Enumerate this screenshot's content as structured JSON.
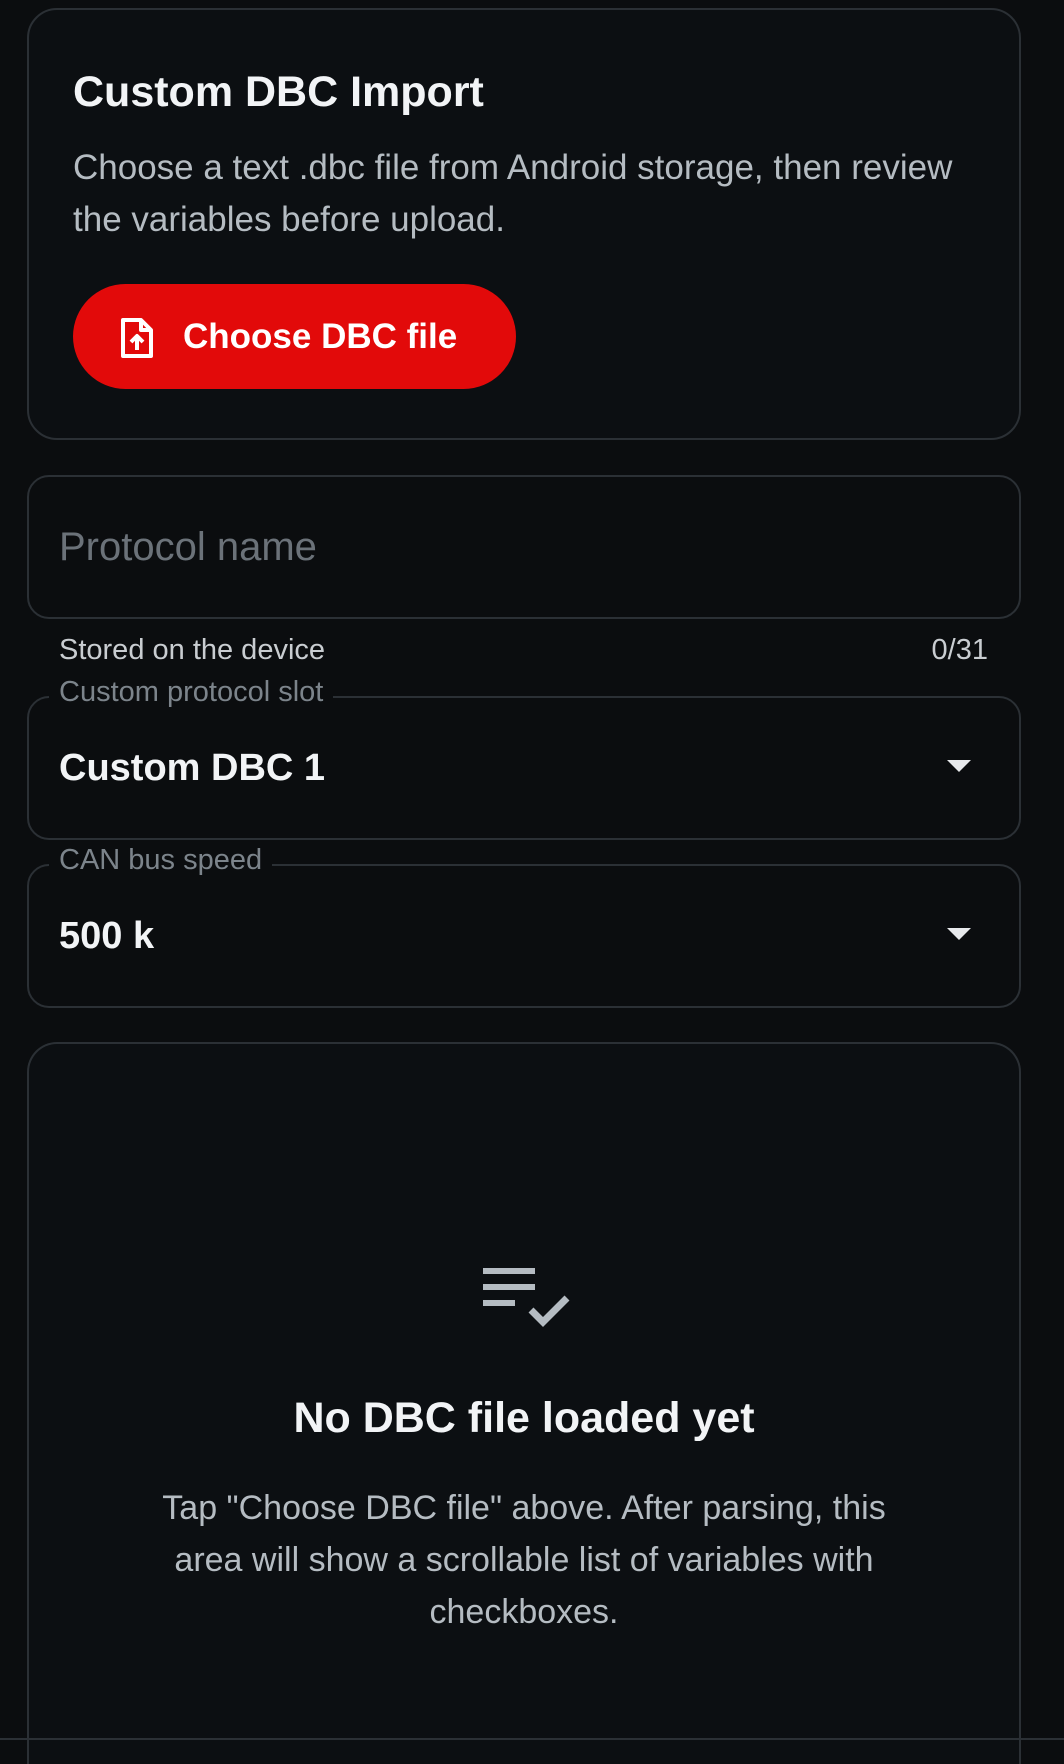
{
  "import_card": {
    "title": "Custom DBC Import",
    "description": "Choose a text .dbc file from Android storage, then review the variables before upload.",
    "choose_button_label": "Choose DBC file",
    "choose_button_icon": "file-upload-icon",
    "accent_color": "#e20a0a"
  },
  "protocol_name": {
    "placeholder": "Protocol name",
    "value": "",
    "helper": "Stored on the device",
    "counter": "0/31"
  },
  "slot": {
    "label": "Custom protocol slot",
    "value": "Custom DBC 1"
  },
  "bus_speed": {
    "label": "CAN bus speed",
    "value": "500 k"
  },
  "empty_state": {
    "icon": "playlist-check-icon",
    "title": "No DBC file loaded yet",
    "description": "Tap \"Choose DBC file\" above. After parsing, this area will show a scrollable list of variables with checkboxes."
  }
}
